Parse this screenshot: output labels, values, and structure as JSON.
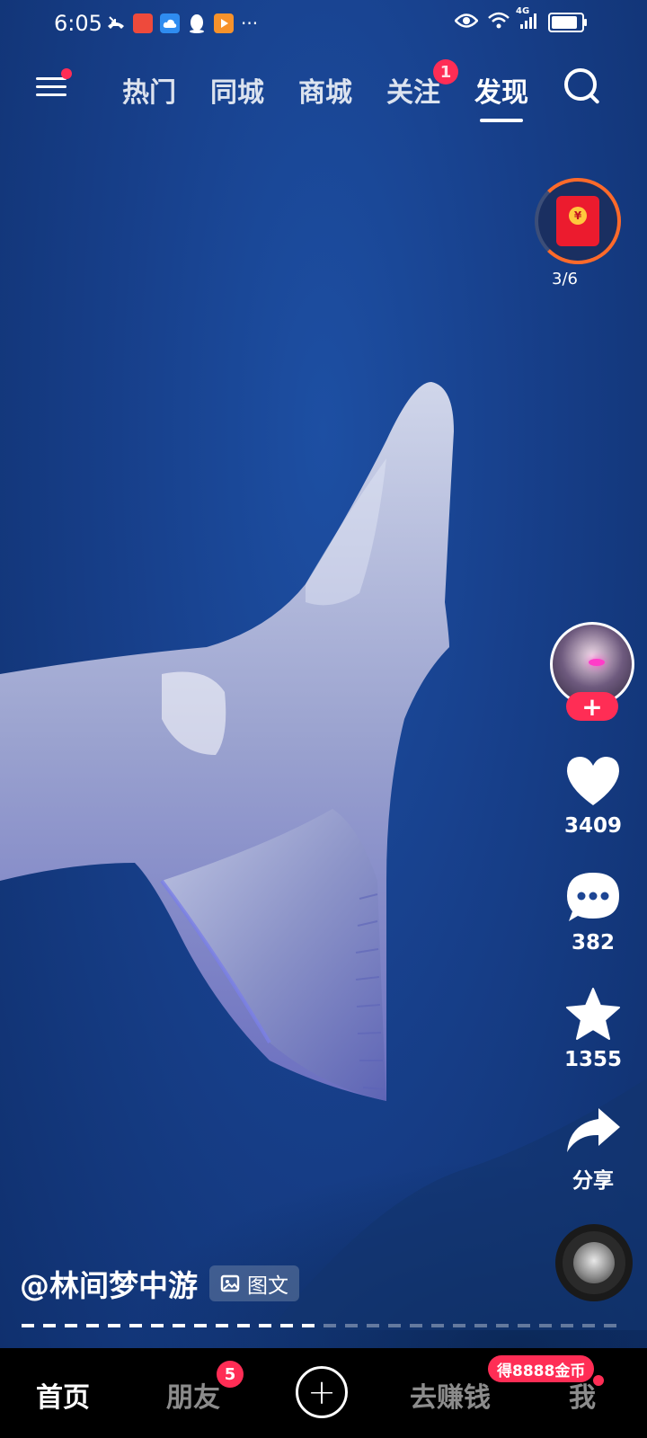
{
  "status_bar": {
    "time": "6:05",
    "signal_label": "4G",
    "more": "···",
    "icons": [
      "missed-call-icon",
      "huawei-app-icon",
      "cloud-icon",
      "qq-icon",
      "video-app-icon",
      "eye-icon",
      "wifi-icon",
      "signal-icon",
      "battery-icon"
    ]
  },
  "top_nav": {
    "tabs": [
      {
        "label": "热门"
      },
      {
        "label": "同城"
      },
      {
        "label": "商城"
      },
      {
        "label": "关注",
        "badge": "1"
      },
      {
        "label": "发现"
      }
    ],
    "active_tab": "发现"
  },
  "red_packet": {
    "coin": "¥",
    "progress": "3/6"
  },
  "actions": {
    "follow_plus": "+",
    "like_count": "3409",
    "comment_count": "382",
    "favorite_count": "1355",
    "share_label": "分享"
  },
  "post": {
    "author": "@林间梦中游",
    "type_tag": "图文",
    "image_progress": 0.5
  },
  "bottom_nav": {
    "home": "首页",
    "friends": "朋友",
    "friends_badge": "5",
    "create": "+",
    "earn": "去赚钱",
    "earn_badge": "得8888金币",
    "me": "我"
  },
  "colors": {
    "accent": "#ff2d55",
    "water": "#173f8a",
    "nav_bg": "#000000"
  }
}
